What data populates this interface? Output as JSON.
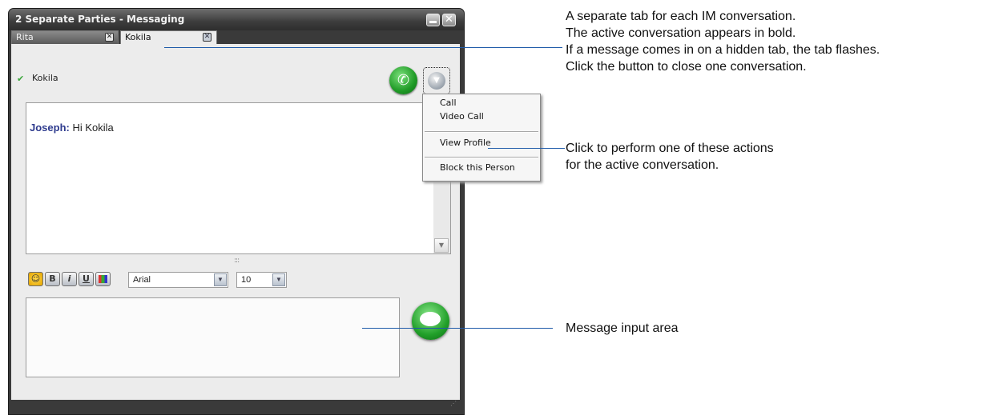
{
  "window": {
    "title": "2 Separate Parties - Messaging",
    "minimize_icon": "minimize-icon",
    "close_glyph": "✕"
  },
  "tabs": [
    {
      "label": "Rita",
      "active": false,
      "close_glyph": "✕"
    },
    {
      "label": "Kokila",
      "active": true,
      "close_glyph": "✕"
    }
  ],
  "contact": {
    "name": "Kokila",
    "status_glyph": "✔"
  },
  "buttons": {
    "call_glyph": "✆",
    "more_glyph": "▼"
  },
  "conversation": [
    {
      "sender": "Joseph:",
      "text": "Hi Kokila"
    }
  ],
  "scroll_down_glyph": "▼",
  "splitter_glyph": ":::",
  "format_toolbar": {
    "smiley_glyph": "☺",
    "bold_label": "B",
    "italic_label": "i",
    "underline_label": "U",
    "font_value": "Arial",
    "size_value": "10",
    "dropdown_glyph": "▼"
  },
  "resize_glyph": "⋰",
  "context_menu": {
    "items": [
      "Call",
      "Video Call",
      "View Profile",
      "Block this Person"
    ]
  },
  "annotations": {
    "tabs": [
      "A separate tab for each IM conversation.",
      "The active conversation appears in bold.",
      "If a message comes in on a hidden tab, the tab flashes.",
      "Click the button to close one conversation."
    ],
    "menu": [
      "Click to perform one of these actions",
      "for the active conversation."
    ],
    "input": "Message input area"
  },
  "colors": {
    "annotation_line": "#1f5ba9",
    "sender_name": "#2e3b8e",
    "call_button": "#22a02a"
  }
}
